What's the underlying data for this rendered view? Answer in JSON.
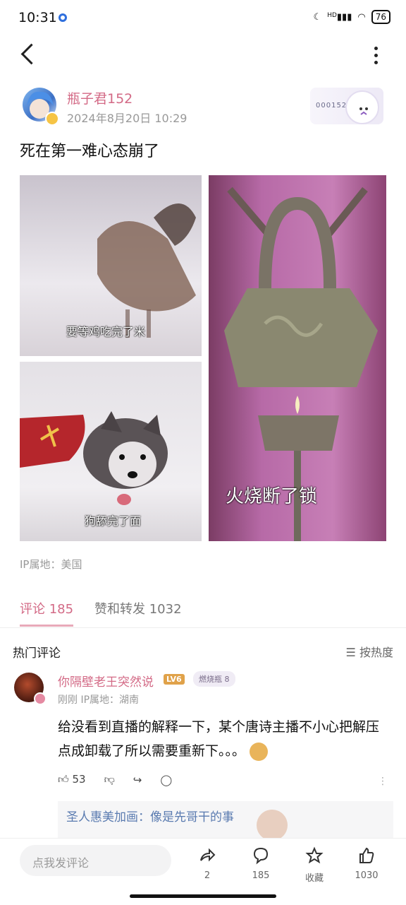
{
  "status_bar": {
    "time": "10:31",
    "signal_label": "HD",
    "battery": "76"
  },
  "post": {
    "author": "瓶子君152",
    "date": "2024年8月20日 10:29",
    "badge_number": "000152",
    "text": "死在第一难心态崩了",
    "images": [
      {
        "caption": "要等鸡吃完了米",
        "icon": "rooster-image"
      },
      {
        "caption": "狗舔完了面",
        "icon": "dog-image"
      },
      {
        "caption": "火烧断了锁",
        "icon": "lock-candle-image"
      }
    ],
    "ip_location": "IP属地：美国"
  },
  "tabs": {
    "comments": "评论 185",
    "reposts": "赞和转发 1032"
  },
  "hot_comments": {
    "title": "热门评论",
    "sort_label": "按热度"
  },
  "comment": {
    "username": "你隔壁老王突然说",
    "level": "LV6",
    "fan_badge": "燃烧瓶",
    "fan_level": "8",
    "time": "刚刚",
    "ip": "IP属地：湖南",
    "text": "给没看到直播的解释一下，某个唐诗主播不小心把解压点成卸载了所以需要重新下。。。",
    "likes": "53",
    "reply_preview": "圣人惠美加画：像是先哥干的事"
  },
  "bottom_bar": {
    "input_placeholder": "点我发评论",
    "share_count": "2",
    "comment_count": "185",
    "collect_label": "收藏",
    "like_count": "1030"
  },
  "colors": {
    "accent": "#d36a86",
    "link": "#5a7bb0"
  }
}
